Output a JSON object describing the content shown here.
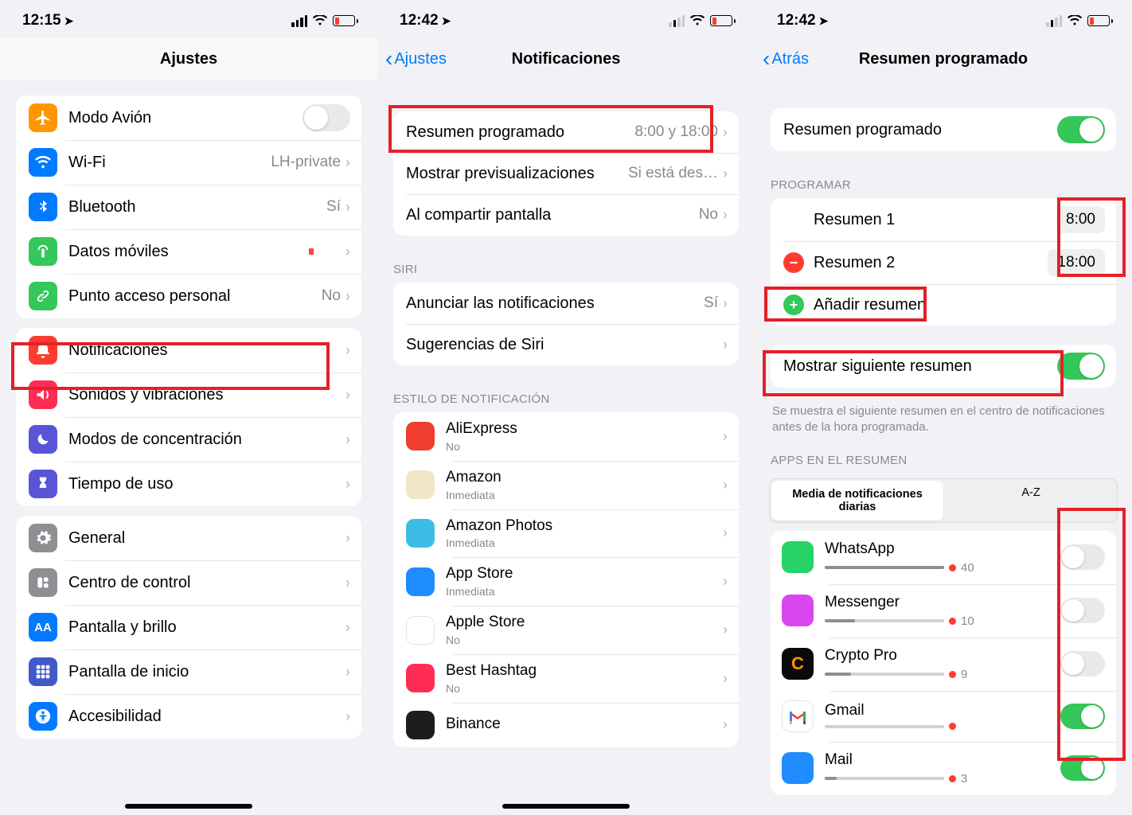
{
  "phone1": {
    "time": "12:15",
    "title": "Ajustes",
    "rows_g1": [
      {
        "label": "Modo Avión",
        "iconBg": "#ff9500",
        "glyph": "plane",
        "toggle": false
      },
      {
        "label": "Wi-Fi",
        "iconBg": "#007aff",
        "glyph": "wifi",
        "value": "LH-private",
        "chev": true
      },
      {
        "label": "Bluetooth",
        "iconBg": "#007aff",
        "glyph": "bt",
        "value": "Sí",
        "chev": true
      },
      {
        "label": "Datos móviles",
        "iconBg": "#34c759",
        "glyph": "ant",
        "chev": true,
        "dot": true
      },
      {
        "label": "Punto acceso personal",
        "iconBg": "#34c759",
        "glyph": "link",
        "value": "No",
        "chev": true
      }
    ],
    "rows_g2": [
      {
        "label": "Notificaciones",
        "iconBg": "#ff3b30",
        "glyph": "bell",
        "chev": true,
        "hl": true
      },
      {
        "label": "Sonidos y vibraciones",
        "iconBg": "#ff2d55",
        "glyph": "sound",
        "chev": true
      },
      {
        "label": "Modos de concentración",
        "iconBg": "#5856d6",
        "glyph": "moon",
        "chev": true
      },
      {
        "label": "Tiempo de uso",
        "iconBg": "#5856d6",
        "glyph": "hour",
        "chev": true
      }
    ],
    "rows_g3": [
      {
        "label": "General",
        "iconBg": "#8e8e93",
        "glyph": "gear",
        "chev": true
      },
      {
        "label": "Centro de control",
        "iconBg": "#8e8e93",
        "glyph": "cc",
        "chev": true
      },
      {
        "label": "Pantalla y brillo",
        "iconBg": "#007aff",
        "glyph": "aa",
        "chev": true
      },
      {
        "label": "Pantalla de inicio",
        "iconBg": "#4359c8",
        "glyph": "grid",
        "chev": true
      },
      {
        "label": "Accesibilidad",
        "iconBg": "#007aff",
        "glyph": "man",
        "chev": true
      }
    ]
  },
  "phone2": {
    "time": "12:42",
    "back": "Ajustes",
    "title": "Notificaciones",
    "g1": [
      {
        "label": "Resumen programado",
        "value": "8:00 y 18:00",
        "chev": true,
        "hl": true
      },
      {
        "label": "Mostrar previsualizaciones",
        "value": "Si está des…",
        "chev": true
      },
      {
        "label": "Al compartir pantalla",
        "value": "No",
        "chev": true
      }
    ],
    "siri_header": "SIRI",
    "g2": [
      {
        "label": "Anunciar las notificaciones",
        "value": "Sí",
        "chev": true
      },
      {
        "label": "Sugerencias de Siri",
        "chev": true
      }
    ],
    "style_header": "ESTILO DE NOTIFICACIÓN",
    "apps": [
      {
        "label": "AliExpress",
        "sub": "No",
        "bg": "#ef3e2e"
      },
      {
        "label": "Amazon",
        "sub": "Inmediata",
        "bg": "#f2e6c8"
      },
      {
        "label": "Amazon Photos",
        "sub": "Inmediata",
        "bg": "#3dbde5"
      },
      {
        "label": "App Store",
        "sub": "Inmediata",
        "bg": "#1f8cff"
      },
      {
        "label": "Apple Store",
        "sub": "No",
        "bg": "#ffffff",
        "border": true
      },
      {
        "label": "Best Hashtag",
        "sub": "No",
        "bg": "#ff2d55"
      },
      {
        "label": "Binance",
        "sub": "",
        "bg": "#1d1d1b"
      }
    ]
  },
  "phone3": {
    "time": "12:42",
    "back": "Atrás",
    "title": "Resumen programado",
    "mainToggle": {
      "label": "Resumen programado",
      "on": true
    },
    "schedule_header": "PROGRAMAR",
    "schedule": [
      {
        "label": "Resumen 1",
        "time": "8:00",
        "delete": false
      },
      {
        "label": "Resumen 2",
        "time": "18:00",
        "delete": true
      }
    ],
    "add": "Añadir resumen",
    "showNext": {
      "label": "Mostrar siguiente resumen",
      "on": true,
      "hl": true
    },
    "note": "Se muestra el siguiente resumen en el centro de notificaciones antes de la hora programada.",
    "apps_header": "APPS EN EL RESUMEN",
    "seg": [
      "Media de notificaciones diarias",
      "A-Z"
    ],
    "apps": [
      {
        "name": "WhatsApp",
        "count": 40,
        "bg": "#25d366",
        "pct": 100,
        "on": false
      },
      {
        "name": "Messenger",
        "count": 10,
        "bg": "#d946ef",
        "pct": 25,
        "on": false
      },
      {
        "name": "Crypto Pro",
        "count": 9,
        "bg": "#0a0a0a",
        "glyph": "C",
        "gcolor": "#ff9500",
        "pct": 22,
        "on": false
      },
      {
        "name": "Gmail",
        "count": "",
        "bg": "#ffffff",
        "gmail": true,
        "pct": 0,
        "on": true
      },
      {
        "name": "Mail",
        "count": 3,
        "bg": "#1f8cff",
        "pct": 10,
        "on": true
      }
    ]
  }
}
